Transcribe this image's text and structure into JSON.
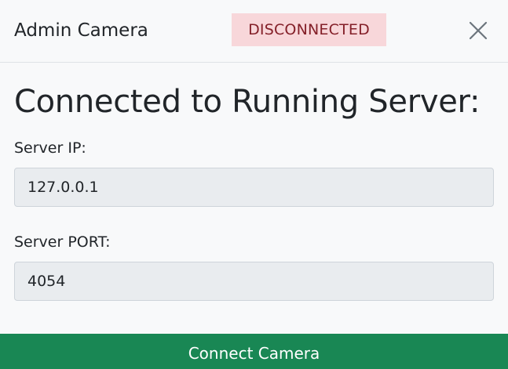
{
  "header": {
    "title": "Admin Camera",
    "status_badge": "DISCONNECTED",
    "close_icon": "close-icon"
  },
  "colors": {
    "badge_bg": "#f8d7da",
    "badge_text": "#842029",
    "connect_button": "#198754",
    "input_bg": "#e9ecef"
  },
  "body": {
    "heading": "Connected to Running Server:",
    "server_ip_label": "Server IP:",
    "server_ip_value": "127.0.0.1",
    "server_port_label": "Server PORT:",
    "server_port_value": "4054"
  },
  "footer": {
    "connect_label": "Connect Camera"
  }
}
